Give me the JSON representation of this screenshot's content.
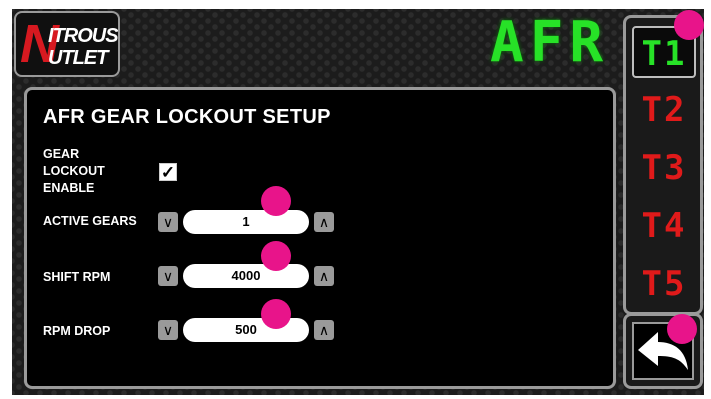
{
  "logo": {
    "line1": "ITROUS",
    "line2": "UTLET",
    "mark": "N"
  },
  "mode_display": "AFR",
  "panel": {
    "title": "AFR GEAR LOCKOUT SETUP",
    "gear_lockout": {
      "label_lines": [
        "GEAR",
        "LOCKOUT",
        "ENABLE"
      ],
      "checked": true,
      "check_glyph": "✓"
    },
    "rows": [
      {
        "label": "ACTIVE GEARS",
        "value": "1"
      },
      {
        "label": "SHIFT RPM",
        "value": "4000"
      },
      {
        "label": "RPM DROP",
        "value": "500"
      }
    ],
    "decrement_glyph": "∨",
    "increment_glyph": "∧"
  },
  "tabs": [
    {
      "label": "T1",
      "active": true
    },
    {
      "label": "T2",
      "active": false
    },
    {
      "label": "T3",
      "active": false
    },
    {
      "label": "T4",
      "active": false
    },
    {
      "label": "T5",
      "active": false
    }
  ],
  "back_button": {
    "icon": "back-arrow-icon"
  },
  "colors": {
    "active_tab": "#27e227",
    "inactive_tab": "#e01a1a",
    "marker": "#e8148a"
  }
}
